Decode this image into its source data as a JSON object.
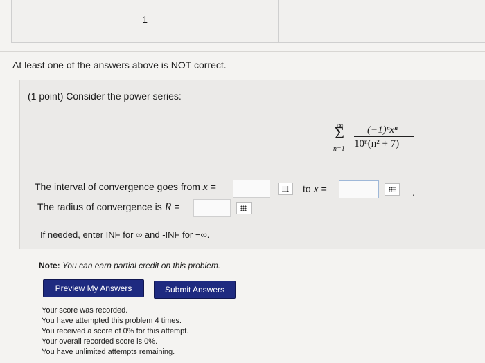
{
  "top_table": {
    "cell_value": "1"
  },
  "notice": "At least one of the answers above is NOT correct.",
  "problem": {
    "prompt": "(1 point) Consider the power series:",
    "formula": {
      "upper": "∞",
      "sigma": "Σ",
      "lower": "n=1",
      "numerator": "(−1)ⁿxⁿ",
      "denominator": "10ⁿ(n² + 7)"
    },
    "interval_label": "The interval of convergence goes from",
    "var_x": "x",
    "equals": "=",
    "interval_from_value": "",
    "to_label": "to",
    "interval_to_value": "",
    "radius_label": "The radius of convergence is",
    "var_r": "R",
    "radius_value": "",
    "period": ".",
    "hint": "If needed, enter INF for ∞ and -INF for −∞."
  },
  "note": {
    "label": "Note:",
    "text": "You can earn partial credit on this problem."
  },
  "buttons": {
    "preview": "Preview My Answers",
    "submit": "Submit Answers"
  },
  "score_messages": [
    "Your score was recorded.",
    "You have attempted this problem 4 times.",
    "You received a score of 0% for this attempt.",
    "Your overall recorded score is 0%.",
    "You have unlimited attempts remaining."
  ],
  "colors": {
    "button_bg": "#1e2a80",
    "background": "#f4f3f1"
  }
}
